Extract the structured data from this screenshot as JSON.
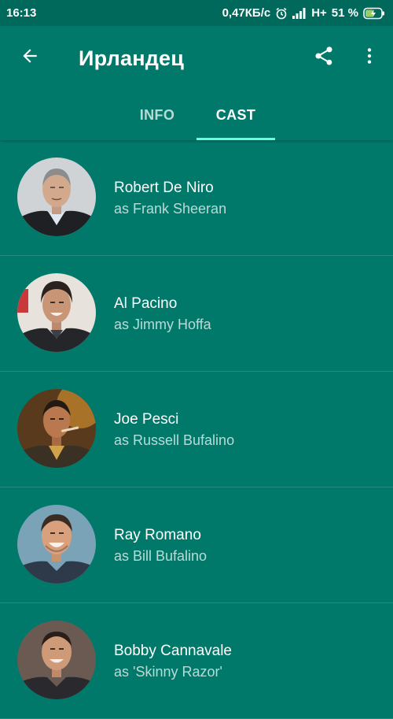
{
  "status_bar": {
    "time": "16:13",
    "net_speed": "0,47КБ/с",
    "network": "H+",
    "battery": "51 %"
  },
  "app_bar": {
    "title": "Ирландец",
    "icons": [
      "back-arrow-icon",
      "share-icon",
      "more-vert-icon"
    ]
  },
  "tabs": [
    {
      "label": "INFO",
      "selected": false
    },
    {
      "label": "CAST",
      "selected": true
    }
  ],
  "colors": {
    "primary": "#00796b",
    "status_bar": "#00695c",
    "tab_indicator": "#64ffda"
  },
  "cast": [
    {
      "name": "Robert De Niro",
      "character": "as Frank Sheeran"
    },
    {
      "name": "Al Pacino",
      "character": "as Jimmy Hoffa"
    },
    {
      "name": "Joe Pesci",
      "character": "as Russell Bufalino"
    },
    {
      "name": "Ray Romano",
      "character": "as Bill Bufalino"
    },
    {
      "name": "Bobby Cannavale",
      "character": "as 'Skinny Razor'"
    }
  ]
}
